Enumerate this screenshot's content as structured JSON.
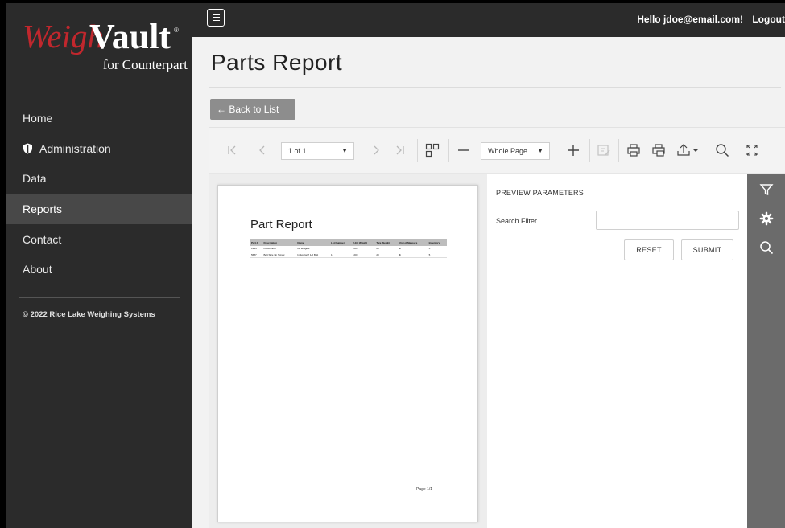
{
  "brand": {
    "logo_word1": "Weigh",
    "logo_word2": "Vault",
    "logo_sub": "for Counterpart",
    "logo_mark": "®"
  },
  "sidebar": {
    "items": [
      {
        "label": "Home",
        "icon": "none"
      },
      {
        "label": "Administration",
        "icon": "shield-icon"
      },
      {
        "label": "Data",
        "icon": "none"
      },
      {
        "label": "Reports",
        "icon": "none",
        "active": true
      },
      {
        "label": "Contact",
        "icon": "none"
      },
      {
        "label": "About",
        "icon": "none"
      }
    ],
    "copyright": "© 2022 Rice Lake Weighing Systems"
  },
  "topbar": {
    "greeting": "Hello jdoe@email.com!",
    "logout": "Logout"
  },
  "page": {
    "title": "Parts Report",
    "back_label": "← Back to List"
  },
  "toolbar": {
    "page_select": "1 of 1",
    "zoom_select": "Whole Page",
    "icons": [
      "first-page-icon",
      "prev-page-icon",
      "next-page-icon",
      "last-page-icon",
      "multipage-icon",
      "zoom-out-icon",
      "zoom-in-icon",
      "highlight-editing-icon",
      "print-icon",
      "print-page-icon",
      "export-icon",
      "search-icon",
      "fullscreen-icon"
    ]
  },
  "report": {
    "title": "Part Report",
    "columns": [
      "Part #",
      "Description",
      "Name",
      "Lot Number",
      "Unit Weight",
      "Tare Weight",
      "Unit of Measure",
      "Inventory"
    ],
    "rows": [
      [
        "1234",
        "Description",
        "All Widgets",
        "",
        "200",
        "20",
        "lb",
        "5"
      ],
      [
        "5687",
        "Bolt Size 3in Screw",
        "Industrial 7 1/2 Bolt",
        "1",
        "200",
        "20",
        "lb",
        "5"
      ]
    ],
    "footer": "Page 1/1"
  },
  "parameters": {
    "title": "PREVIEW PARAMETERS",
    "search_label": "Search Filter",
    "search_value": "",
    "reset": "RESET",
    "submit": "SUBMIT"
  },
  "rail": {
    "icons": [
      "filter-icon",
      "settings-icon",
      "search-icon"
    ]
  },
  "colors": {
    "sidebar_bg": "#2b2b2b",
    "logo_red": "#c1272d",
    "active_item": "#484848",
    "rail_bg": "#6b6b6b",
    "back_button": "#8d8d8d"
  }
}
